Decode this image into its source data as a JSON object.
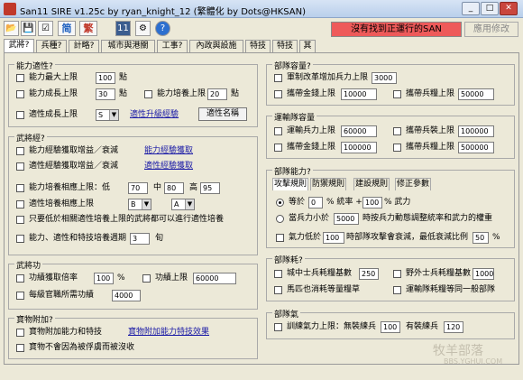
{
  "window": {
    "title": "San11 SIRE v1.25c by ryan_knight_12 (繁體化 by Dots@HKSAN)",
    "min": "_",
    "max": "□",
    "close": "✕"
  },
  "toolbar": {
    "buttons": [
      {
        "icon": "open-icon",
        "glyph": "📂"
      },
      {
        "icon": "save-icon",
        "glyph": "💾"
      },
      {
        "icon": "check-icon",
        "glyph": "☑"
      },
      {
        "label": "简"
      },
      {
        "label": "繁"
      },
      {
        "icon": "calendar-icon",
        "glyph": "11"
      },
      {
        "icon": "gear-icon",
        "glyph": "⚙"
      },
      {
        "icon": "help-icon",
        "glyph": "?"
      }
    ],
    "status": "沒有找到正運行的SAN",
    "apply": "應用修改"
  },
  "tabs": [
    "武將?",
    "兵種?",
    "計略?",
    "城市與港關",
    "工事?",
    "內政與設施",
    "特技",
    "特技",
    "其"
  ],
  "ability": {
    "title": "能力適性?",
    "max_label": "能力最大上限",
    "max_value": "100",
    "unit": "點",
    "growth_label": "能力成長上限",
    "growth_value": "30",
    "train_label": "能力培養上限",
    "train_value": "20",
    "apt_label": "適性成長上限",
    "apt_value": "S",
    "apt_link": "適性升級經驗",
    "apt_button": "適性名稱"
  },
  "experience": {
    "title": "武將經?",
    "row1": "能力經驗獲取增益／衰減",
    "link1": "能力經驗獲取",
    "row2": "適性經驗獲取增益／衰減",
    "link2": "適性經驗獲取",
    "cap_label": "能力培養相應上限：低",
    "low": "70",
    "mid_label": "中",
    "mid": "80",
    "high_label": "高",
    "high": "95",
    "apt_cap_label": "適性培養相應上限",
    "b_value": "B",
    "a_value": "A",
    "row_only": "只要低於相關適性培養上限的武將都可以進行適性培養",
    "cycle_label": "能力、適性和特技培養週期",
    "cycle_value": "3",
    "cycle_unit": "旬"
  },
  "merit": {
    "title": "武將功",
    "rate_label": "功績獲取倍率",
    "rate_value": "100",
    "rate_unit": "%",
    "cap_label": "功績上限",
    "cap_value": "60000",
    "rank_label": "每級官職所需功績",
    "rank_value": "4000"
  },
  "treasure": {
    "title": "寶物附加?",
    "row1": "寶物附加能力和特技",
    "link1": "寶物附加能力特技效果",
    "row2": "寶物不會因為被俘虜而被沒收"
  },
  "troops": {
    "title": "部隊容量?",
    "row1": "軍制改革增加兵力上限",
    "row1_value": "3000",
    "gold_label": "攜帶金錢上限",
    "gold_value": "10000",
    "grain_label": "攜帶兵糧上限",
    "grain_value": "50000"
  },
  "transport": {
    "title": "運輸隊容量",
    "troops_label": "運輸兵力上限",
    "troops_value": "60000",
    "soldiers_label": "攜帶兵裝上限",
    "soldiers_value": "100000",
    "gold_label": "攜帶金錢上限",
    "gold_value": "100000",
    "grain_label": "攜帶兵糧上限",
    "grain_value": "500000"
  },
  "unit_ability": {
    "title": "部隊能力?",
    "subtabs": [
      "攻擊規則",
      "防禦規則",
      "建設規則",
      "修正參數"
    ],
    "equal_label": "等於",
    "equal_value": "0",
    "rate_text": "% 統率 +",
    "rate_value": "100",
    "rate_tail": "% 武力",
    "troop_label": "當兵力小於",
    "troop_value": "5000",
    "troop_tail": "時按兵力動態調整統率和武力的權重",
    "morale_label": "氣力低於",
    "morale_value": "100",
    "morale_mid": "時部隊攻擊會衰減，最低衰減比例",
    "morale_min": "50",
    "morale_unit": "%"
  },
  "upkeep": {
    "title": "部隊耗?",
    "city_label": "城中士兵耗糧基數",
    "city_value": "250",
    "field_label": "野外士兵耗糧基數",
    "field_value": "1000",
    "horse_label": "馬匹也消耗等量糧草",
    "transport_label": "運輸隊耗糧等同一般部隊"
  },
  "morale": {
    "title": "部隊氣",
    "label": "訓練氣力上限：無裝練兵",
    "value1": "100",
    "mid": "有裝練兵",
    "value2": "120"
  },
  "watermark": {
    "line1": "牧羊部落",
    "line2": "BBS.YGHUI.COM"
  }
}
